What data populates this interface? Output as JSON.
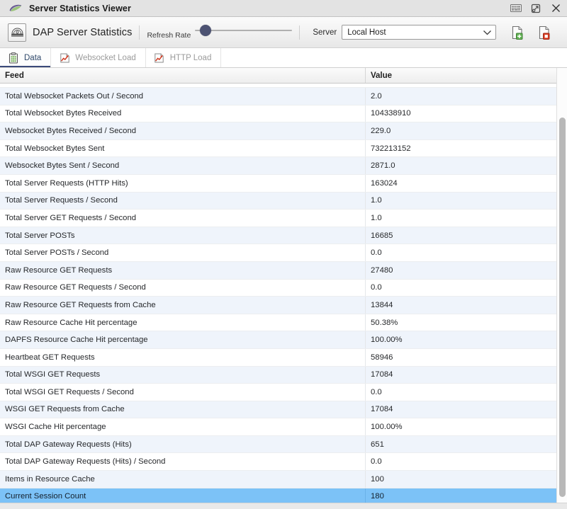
{
  "window": {
    "title": "Server Statistics Viewer",
    "logo_icon": "app-logo-icon",
    "buttons": [
      {
        "name": "keyboard-icon",
        "label": "Keyboard"
      },
      {
        "name": "restore-icon",
        "label": "Restore"
      },
      {
        "name": "close-icon",
        "label": "Close"
      }
    ]
  },
  "toolbar": {
    "app_icon": "dap-dome-icon",
    "app_title": "DAP Server Statistics",
    "refresh_rate_label": "Refresh Rate",
    "refresh_rate_value": 6,
    "server_label": "Server",
    "server_value": "Local Host",
    "server_options": [
      "Local Host"
    ],
    "dropdown_icon": "chevron-down-icon",
    "action_buttons": [
      {
        "name": "new-document-icon",
        "badge_color": "#3fa13f",
        "label": "Save Statistics"
      },
      {
        "name": "stop-document-icon",
        "badge_color": "#d12b1f",
        "label": "Stop Statistics"
      }
    ]
  },
  "tabs": [
    {
      "label": "Data",
      "icon": "clipboard-icon",
      "active": true
    },
    {
      "label": "Websocket Load",
      "icon": "line-chart-icon",
      "active": false
    },
    {
      "label": "HTTP Load",
      "icon": "line-chart-icon",
      "active": false
    }
  ],
  "table": {
    "columns": [
      "Feed",
      "Value"
    ],
    "selected_index": 23,
    "rows": [
      {
        "feed": "Total Websocket Packets Out / Second",
        "value": "2.0"
      },
      {
        "feed": "Total Websocket Bytes Received",
        "value": "104338910"
      },
      {
        "feed": "Websocket Bytes Received / Second",
        "value": "229.0"
      },
      {
        "feed": "Total Websocket Bytes Sent",
        "value": "732213152"
      },
      {
        "feed": "Websocket Bytes Sent / Second",
        "value": "2871.0"
      },
      {
        "feed": "Total Server Requests (HTTP Hits)",
        "value": "163024"
      },
      {
        "feed": "Total Server Requests / Second",
        "value": "1.0"
      },
      {
        "feed": "Total Server GET Requests / Second",
        "value": "1.0"
      },
      {
        "feed": "Total Server POSTs",
        "value": "16685"
      },
      {
        "feed": "Total Server POSTs / Second",
        "value": "0.0"
      },
      {
        "feed": "Raw Resource GET Requests",
        "value": "27480"
      },
      {
        "feed": "Raw Resource GET Requests / Second",
        "value": "0.0"
      },
      {
        "feed": "Raw Resource GET Requests from Cache",
        "value": "13844"
      },
      {
        "feed": "Raw Resource Cache Hit percentage",
        "value": "50.38%"
      },
      {
        "feed": "DAPFS Resource Cache Hit percentage",
        "value": "100.00%"
      },
      {
        "feed": "Heartbeat GET Requests",
        "value": "58946"
      },
      {
        "feed": "Total WSGI GET Requests",
        "value": "17084"
      },
      {
        "feed": "Total WSGI GET Requests / Second",
        "value": "0.0"
      },
      {
        "feed": "WSGI GET Requests from Cache",
        "value": "17084"
      },
      {
        "feed": "WSGI Cache Hit percentage",
        "value": "100.00%"
      },
      {
        "feed": "Total DAP Gateway Requests (Hits)",
        "value": "651"
      },
      {
        "feed": "Total DAP Gateway Requests (Hits) / Second",
        "value": "0.0"
      },
      {
        "feed": "Items in Resource Cache",
        "value": "100"
      },
      {
        "feed": "Current Session Count",
        "value": "180"
      }
    ]
  },
  "scrollbar": {
    "orientation": "vertical",
    "thumb_name": "vertical-scroll-thumb"
  },
  "colors": {
    "selection": "#7cc2f7",
    "row_alt": "#eff4fb",
    "tab_accent": "#3b4a7a",
    "slider_thumb": "#4d5373"
  }
}
